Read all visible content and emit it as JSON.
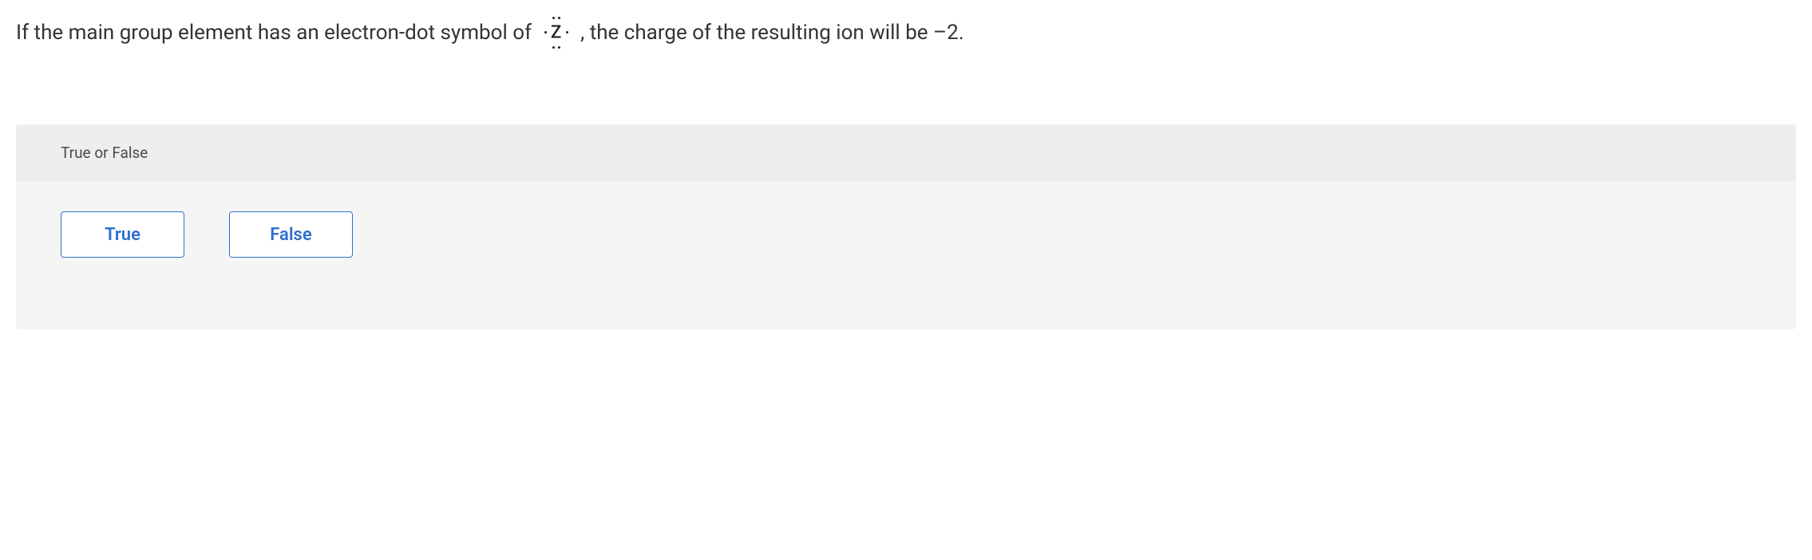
{
  "question": {
    "text_before": "If the main group element has an electron-dot symbol of",
    "text_after": ", the charge of the resulting ion will be –2.",
    "lewis": {
      "symbol": "Z",
      "dot_count": 6
    }
  },
  "panel": {
    "header": "True or False",
    "options": {
      "true_label": "True",
      "false_label": "False"
    }
  }
}
